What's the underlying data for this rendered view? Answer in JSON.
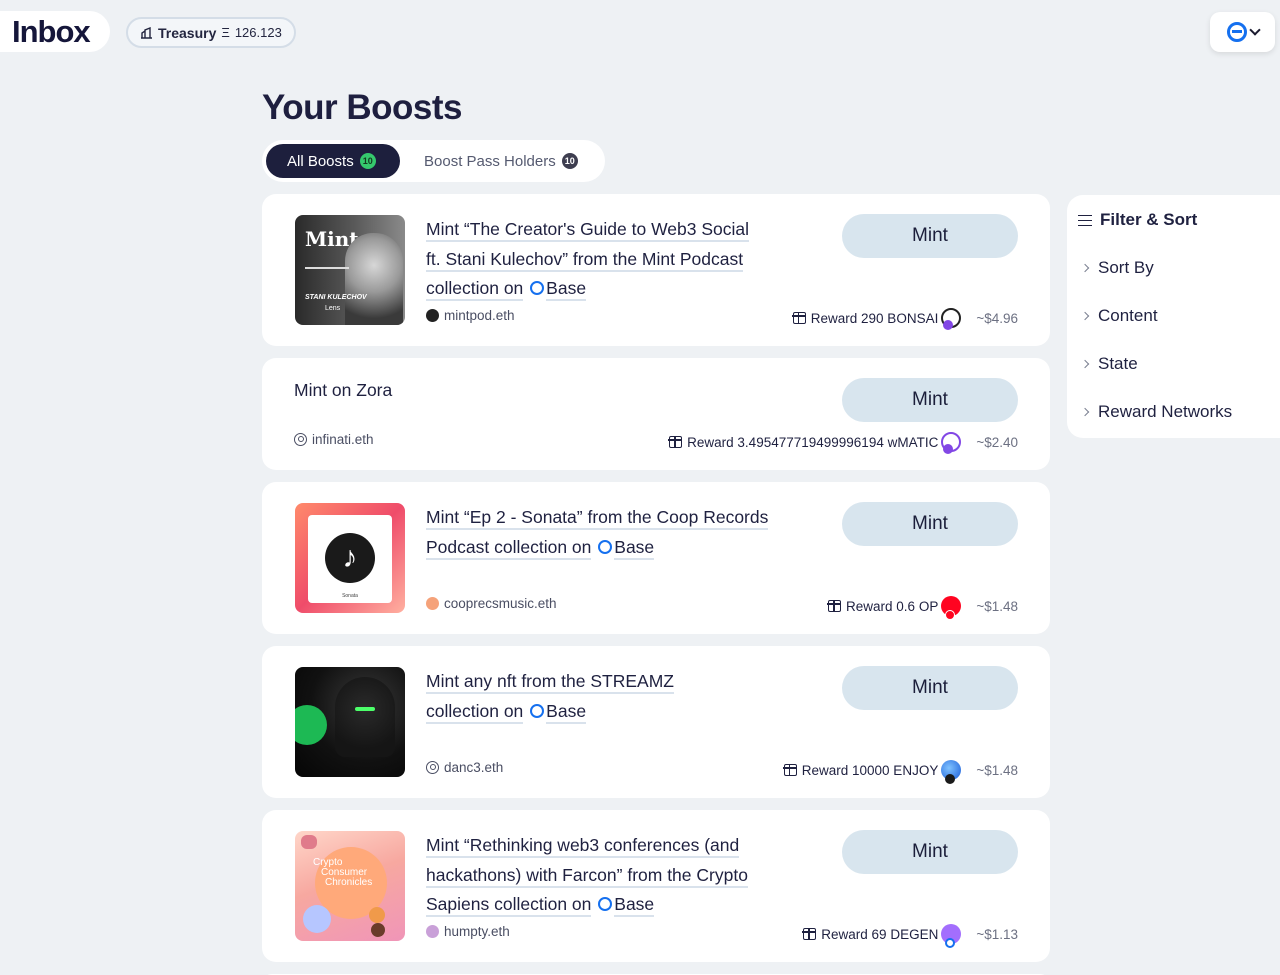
{
  "app": {
    "title": "Inbox"
  },
  "treasury": {
    "label": "Treasury",
    "symbol": "Ξ",
    "amount": "126.123"
  },
  "page": {
    "title": "Your Boosts"
  },
  "tabs": [
    {
      "label": "All Boosts",
      "count": "10",
      "active": true
    },
    {
      "label": "Boost Pass Holders",
      "count": "10",
      "active": false
    }
  ],
  "mint_label": "Mint",
  "boosts": [
    {
      "title_lines": [
        "Mint “The Creator's Guide to Web3 Social",
        "ft. Stani Kulechov” from the Mint Podcast",
        "collection on"
      ],
      "network": "Base",
      "author": "mintpod.eth",
      "reward": "Reward 290 BONSAI",
      "usd": "~$4.96",
      "thumb_text": {
        "brand": "Mint",
        "name": "STANI KULECHOV",
        "tag": "Lens"
      }
    },
    {
      "title": "Mint on Zora",
      "author": "infinati.eth",
      "reward": "Reward 3.495477719499996194 wMATIC",
      "usd": "~$2.40"
    },
    {
      "title_lines": [
        "Mint “Ep 2 - Sonata” from the Coop Records",
        "Podcast collection on"
      ],
      "network": "Base",
      "author": "cooprecsmusic.eth",
      "reward": "Reward 0.6 OP",
      "usd": "~$1.48",
      "thumb_text": {
        "caption": "Sonata"
      }
    },
    {
      "title_lines": [
        "Mint any nft from the STREAMZ",
        "collection on"
      ],
      "network": "Base",
      "author": "danc3.eth",
      "reward": "Reward 10000 ENJOY",
      "usd": "~$1.48"
    },
    {
      "title_lines": [
        "Mint “Rethinking web3 conferences (and",
        "hackathons) with Farcon” from the Crypto",
        "Sapiens collection on"
      ],
      "network": "Base",
      "author": "humpty.eth",
      "reward": "Reward 69 DEGEN",
      "usd": "~$1.13",
      "thumb_text": {
        "line1": "Crypto",
        "line2": "Consumer",
        "line3": "Chronicles"
      }
    }
  ],
  "filter": {
    "title": "Filter & Sort",
    "options": [
      "Sort By",
      "Content",
      "State",
      "Reward Networks"
    ]
  },
  "colors": {
    "accent": "#1570ef",
    "dark": "#1d1f3d",
    "mint_button": "#d8e5ee",
    "count_badge": "#35c96d"
  }
}
